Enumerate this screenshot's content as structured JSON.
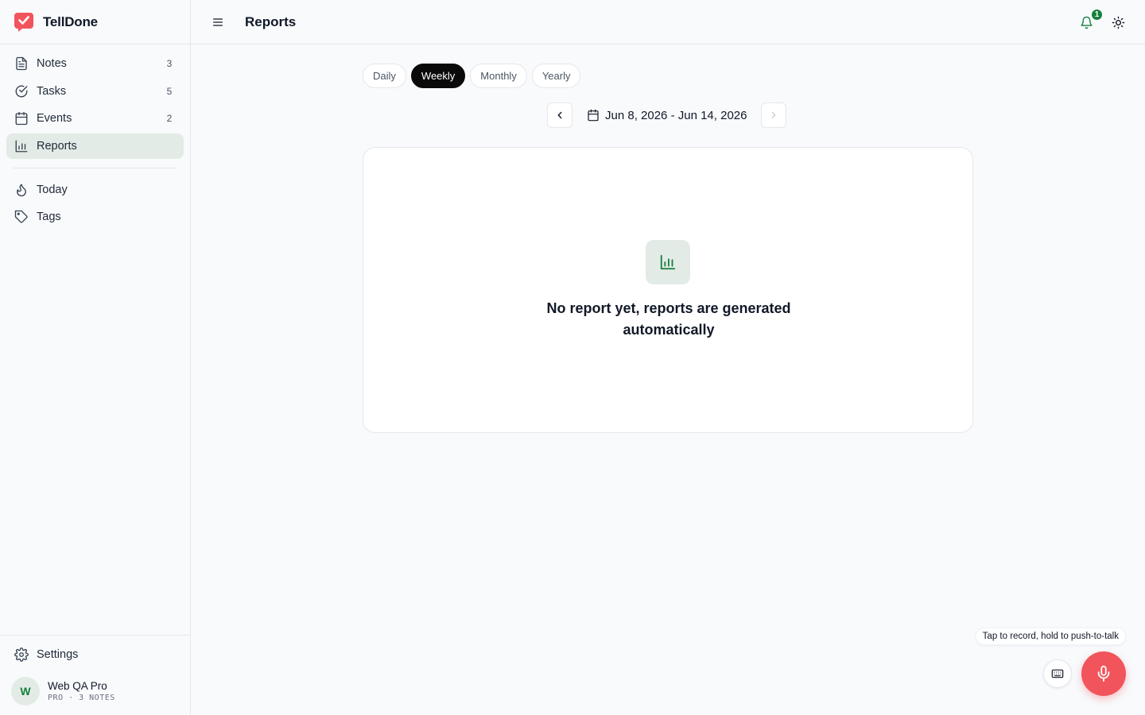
{
  "app": {
    "name": "TellDone",
    "brand_color": "#f2545b",
    "accent_color": "#15803d"
  },
  "sidebar": {
    "items": [
      {
        "label": "Notes",
        "count": "3",
        "icon": "file-text-icon"
      },
      {
        "label": "Tasks",
        "count": "5",
        "icon": "check-circle-icon"
      },
      {
        "label": "Events",
        "count": "2",
        "icon": "calendar-icon"
      },
      {
        "label": "Reports",
        "count": "",
        "icon": "bar-chart-icon",
        "active": true
      }
    ],
    "secondary": [
      {
        "label": "Today",
        "icon": "flame-icon"
      },
      {
        "label": "Tags",
        "icon": "tag-icon"
      }
    ],
    "settings_label": "Settings",
    "user": {
      "initial": "W",
      "name": "Web QA Pro",
      "meta": "PRO · 3 NOTES"
    }
  },
  "header": {
    "title": "Reports",
    "notification_count": "1"
  },
  "period_tabs": [
    {
      "label": "Daily"
    },
    {
      "label": "Weekly",
      "active": true
    },
    {
      "label": "Monthly"
    },
    {
      "label": "Yearly"
    }
  ],
  "date_range": {
    "label": "Jun 8, 2026 - Jun 14, 2026"
  },
  "empty_state": {
    "message": "No report yet, reports are generated automatically"
  },
  "voice": {
    "tooltip": "Tap to record, hold to push-to-talk"
  }
}
